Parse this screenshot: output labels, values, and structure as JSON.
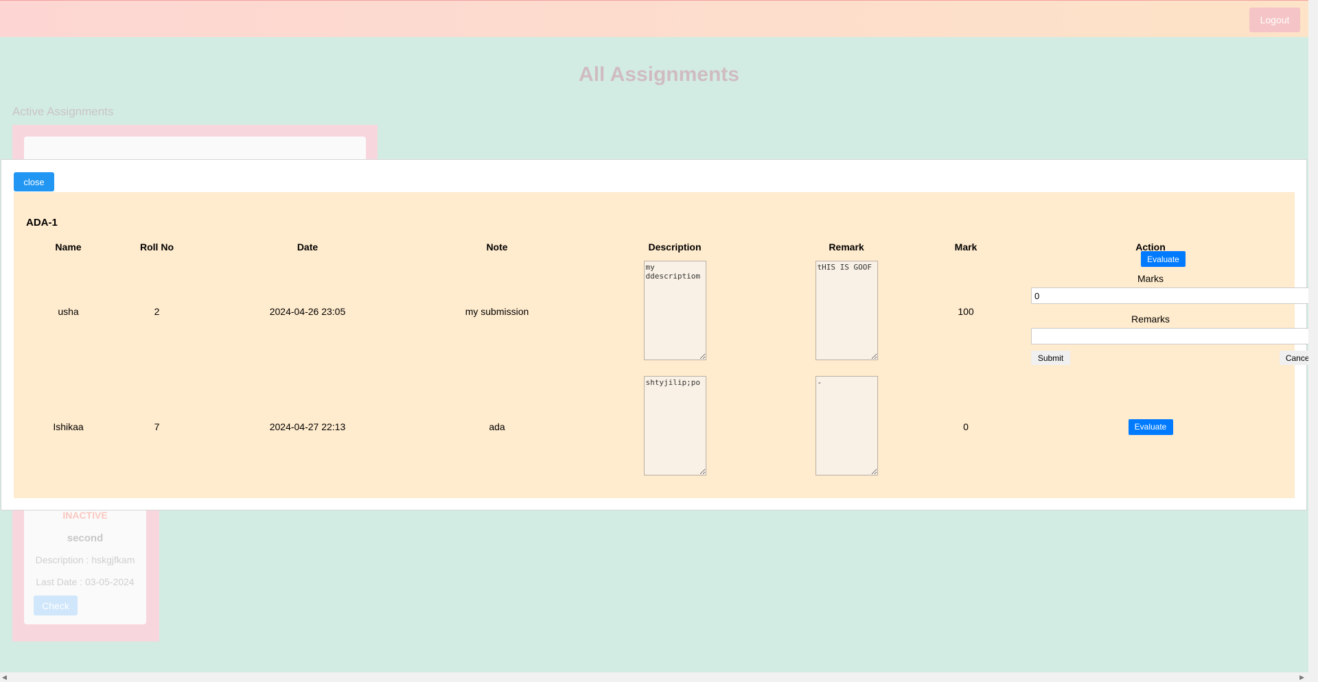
{
  "topbar": {
    "logout_label": "Logout"
  },
  "page": {
    "title": "All Assignments",
    "active_section": "Active Assignments",
    "inactive_card": {
      "status": "INACTIVE",
      "name": "second",
      "description": "Description : hskgjfkam",
      "last_date": "Last Date : 03-05-2024",
      "check_label": "Check"
    }
  },
  "modal": {
    "close_label": "close",
    "assignment_title": "ADA-1",
    "columns": [
      "Name",
      "Roll No",
      "Date",
      "Note",
      "Description",
      "Remark",
      "Mark",
      "Action"
    ],
    "rows": [
      {
        "name": "usha",
        "roll": "2",
        "date": "2024-04-26 23:05",
        "note": "my submission",
        "description": "my ddescriptiom",
        "remark": "tHIS IS GOOF",
        "mark": "100"
      },
      {
        "name": "Ishikaa",
        "roll": "7",
        "date": "2024-04-27 22:13",
        "note": "ada",
        "description": "shtyjilip;po",
        "remark": "-",
        "mark": "0"
      }
    ],
    "evaluate_label": "Evaluate",
    "form": {
      "marks_label": "Marks",
      "marks_value": "0",
      "remarks_label": "Remarks",
      "remarks_value": "",
      "submit_label": "Submit",
      "cancel_label": "Cancel"
    }
  }
}
